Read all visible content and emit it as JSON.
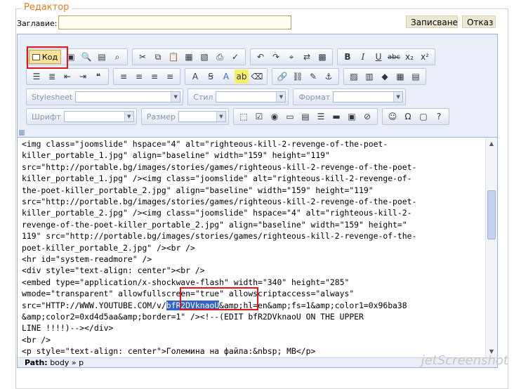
{
  "window": {
    "legend": "Редактор"
  },
  "form": {
    "title_label": "Заглавие:",
    "title_value": ""
  },
  "actions": {
    "save": "Записване",
    "cancel": "Отказ"
  },
  "toolbar": {
    "code_label": "Код",
    "bold": "B",
    "italic": "I",
    "underline": "U",
    "strike": "abc",
    "subscript": "x₂",
    "superscript": "x²",
    "quote": "❝",
    "stylesheet_label": "Stylesheet",
    "style_label": "Стил",
    "format_label": "Формат",
    "font_label": "Шрифт",
    "size_label": "Размер"
  },
  "code_lines": [
    "<img class=\"joomslide\" hspace=\"4\" alt=\"righteous-kill-2-revenge-of-the-poet-",
    "killer_portable_1.jpg\" align=\"baseline\" width=\"159\" height=\"119\"",
    "src=\"http://portable.bg/images/stories/games/righteous-kill-2-revenge-of-the-poet-",
    "killer_portable_1.jpg\" /><img class=\"joomslide\" alt=\"righteous-kill-2-revenge-of-",
    "the-poet-killer_portable_2.jpg\" align=\"baseline\" width=\"159\" height=\"119\"",
    "src=\"http://portable.bg/images/stories/games/righteous-kill-2-revenge-of-the-poet-",
    "killer_portable_2.jpg\" /><img class=\"joomslide\" hspace=\"4\" alt=\"righteous-kill-2-",
    "revenge-of-the-poet-killer_portable_2.jpg\" align=\"baseline\" width=\"159\" height=\"",
    "119\" src=\"http://portable.bg/images/stories/games/righteous-kill-2-revenge-of-the-",
    "poet-killer_portable_2.jpg\" /><br />",
    "<hr id=\"system-readmore\" />",
    "<div style=\"text-align: center\"><br />",
    "<embed type=\"application/x-shockwave-flash\" width=\"340\" height=\"285\"",
    "wmode=\"transparent\" allowfullscreen=\"true\" allowscriptaccess=\"always\"",
    "src=\"HTTP://WWW.YOUTUBE.COM/v/",
    "&amp;color2=0xd4d5aa&amp;border=1\" /><!--(EDIT bfR2DVknaoU ON THE UPPER",
    "LINE !!!!)--></div>",
    "<br />",
    "<p style=\"text-align: center\">Големина на файла:&nbsp; MB</p>"
  ],
  "code_highlight": {
    "text": "bfR2DVknaoU",
    "after": "&amp;hl=en&amp;fs=1&amp;color1=0x96ba38"
  },
  "status": {
    "label": "Path:",
    "path": "body » p"
  },
  "watermark": "jetScreenshot"
}
